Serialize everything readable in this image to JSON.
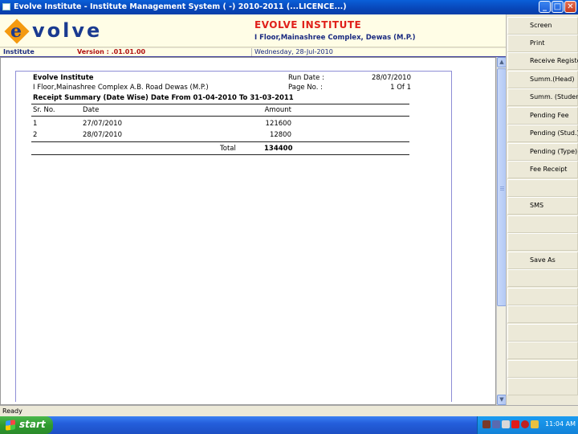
{
  "window": {
    "title": "Evolve Institute - Institute Management System ( -) 2010-2011 (...LICENCE...)"
  },
  "header": {
    "logo_e": "e",
    "logo_rest": "volve",
    "institute_name": "EVOLVE INSTITUTE",
    "institute_address": "I Floor,Mainashree Complex, Dewas (M.P.)",
    "section": "Institute",
    "version": "Version : .01.01.00",
    "date": "Wednesday, 28-Jul-2010"
  },
  "report": {
    "org_name": "Evolve Institute",
    "org_address": "I Floor,Mainashree Complex A.B. Road Dewas (M.P.)",
    "run_date_label": "Run Date :",
    "run_date": "28/07/2010",
    "page_no_label": "Page No. :",
    "page_no": "1 Of 1",
    "title": "Receipt Summary (Date Wise) Date From 01-04-2010 To 31-03-2011",
    "columns": [
      "Sr. No.",
      "Date",
      "Amount"
    ],
    "rows": [
      {
        "sr": "1",
        "date": "27/07/2010",
        "amount": "121600"
      },
      {
        "sr": "2",
        "date": "28/07/2010",
        "amount": "12800"
      }
    ],
    "total_label": "Total",
    "total": "134400"
  },
  "toolbar": {
    "buttons": [
      "Screen",
      "Print",
      "Receive Register",
      "Summ.(Head)",
      "Summ. (Student)",
      "Pending Fee",
      "Pending (Stud.)",
      "Pending (Type)",
      "Fee Receipt",
      "",
      "SMS",
      "",
      "",
      "Save As",
      "",
      "",
      "",
      "",
      "",
      "",
      ""
    ]
  },
  "status": {
    "text": "Ready"
  },
  "taskbar": {
    "start_label": "start",
    "clock": "11:04 AM"
  },
  "colors": {
    "title_bar": "#0a5fd8",
    "institute_name": "#e0201a",
    "logo_diamond": "#f49a10",
    "logo_text": "#1a3a90",
    "page_border": "#8e8ed6"
  }
}
